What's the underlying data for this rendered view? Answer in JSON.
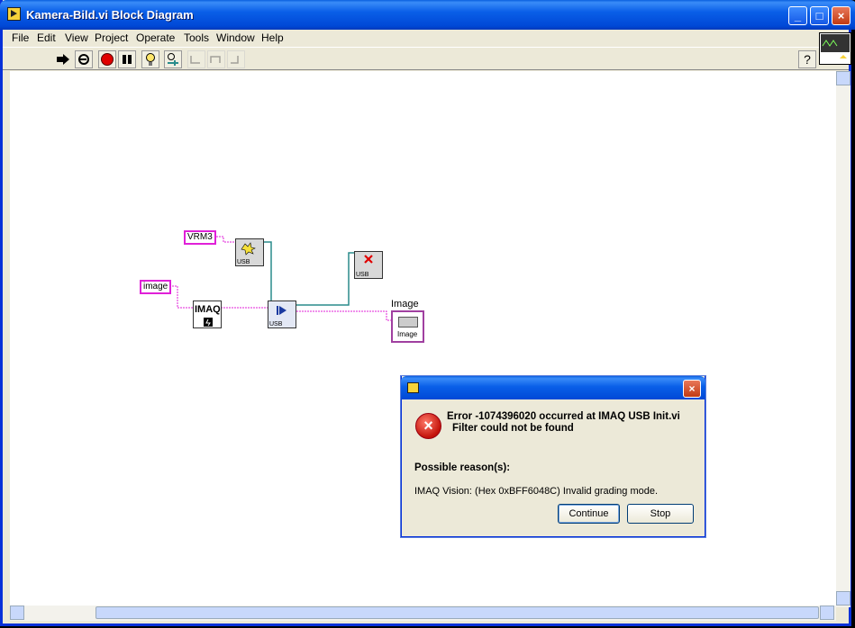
{
  "window": {
    "title": "Kamera-Bild.vi Block Diagram"
  },
  "menu": [
    "File",
    "Edit",
    "View",
    "Project",
    "Operate",
    "Tools",
    "Window",
    "Help"
  ],
  "toolbar": {
    "icons": [
      "run-arrow-icon",
      "run-continuous-icon",
      "abort-icon",
      "pause-icon",
      "highlight-execution-icon",
      "retain-wire-values-icon",
      "step-into-icon",
      "step-over-icon",
      "step-out-icon"
    ],
    "help": "?"
  },
  "diagram": {
    "constants": {
      "vrm": "VRM3",
      "image_name": "image"
    },
    "nodes": {
      "usb_label": "USB",
      "imaq_label": "IMAQ",
      "indicator_title": "Image",
      "indicator_label": "Image"
    }
  },
  "dialog": {
    "error_line": "Error -1074396020 occurred at IMAQ USB Init.vi",
    "error_detail": "Filter could not be found",
    "reason_heading": "Possible reason(s):",
    "reason_text": "IMAQ Vision:  (Hex 0xBFF6048C) Invalid grading mode.",
    "continue_label": "Continue",
    "stop_label": "Stop"
  },
  "colors": {
    "accent": "#0a5fde",
    "wire_pink": "#e020d8",
    "wire_teal": "#2a8c8c"
  }
}
